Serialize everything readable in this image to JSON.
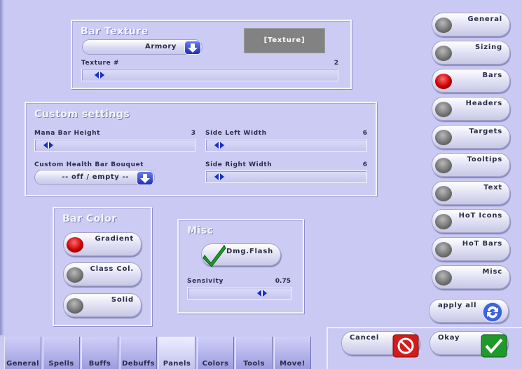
{
  "bar_texture": {
    "title": "Bar Texture",
    "texture_dropdown": "Armory",
    "texture_preview": "[Texture]",
    "texture_num_label": "Texture #",
    "texture_num_value": "2",
    "texture_num_level": 0.05
  },
  "custom_settings": {
    "title": "Custom settings",
    "mana_bar_height_label": "Mana Bar Height",
    "mana_bar_height_value": "3",
    "mana_bar_height_level": 0.05,
    "side_left_width_label": "Side Left Width",
    "side_left_width_value": "6",
    "side_left_width_level": 0.05,
    "bouquet_label": "Custom Health Bar Bouquet",
    "bouquet_dropdown": "-- off / empty --",
    "side_right_width_label": "Side Right Width",
    "side_right_width_value": "6",
    "side_right_width_level": 0.05
  },
  "bar_color": {
    "title": "Bar Color",
    "options": [
      {
        "label": "Gradient",
        "selected": true
      },
      {
        "label": "Class Col.",
        "selected": false
      },
      {
        "label": "Solid",
        "selected": false
      }
    ]
  },
  "misc": {
    "title": "Misc",
    "dmg_flash_label": "Dmg.Flash",
    "dmg_flash_checked": true,
    "sensivity_label": "Sensivity",
    "sensivity_value": "0.75",
    "sensivity_level": 0.75
  },
  "right_nav": [
    {
      "label": "General",
      "active": false
    },
    {
      "label": "Sizing",
      "active": false
    },
    {
      "label": "Bars",
      "active": true
    },
    {
      "label": "Headers",
      "active": false
    },
    {
      "label": "Targets",
      "active": false
    },
    {
      "label": "Tooltips",
      "active": false
    },
    {
      "label": "Text",
      "active": false
    },
    {
      "label": "HoT Icons",
      "active": false
    },
    {
      "label": "HoT Bars",
      "active": false
    },
    {
      "label": "Misc",
      "active": false
    }
  ],
  "actions": {
    "apply_all": "apply all",
    "cancel": "Cancel",
    "okay": "Okay"
  },
  "bottom_tabs": [
    {
      "label": "General",
      "active": false
    },
    {
      "label": "Spells",
      "active": false
    },
    {
      "label": "Buffs",
      "active": false
    },
    {
      "label": "Debuffs",
      "active": false
    },
    {
      "label": "Panels",
      "active": true
    },
    {
      "label": "Colors",
      "active": false
    },
    {
      "label": "Tools",
      "active": false
    },
    {
      "label": "Move!",
      "active": false
    }
  ],
  "colors": {
    "window_bg": "#c9c9f3",
    "panel_title": "#f4f4ff",
    "led_on": "#c90000",
    "led_off": "#6f6f6f",
    "arrow_blue": "#1c2fb8",
    "ok_green": "#1f9a2a",
    "cancel_red": "#d21c1c"
  },
  "icons": {
    "dropdown_arrow": "arrow-down-icon",
    "slider_thumb": "double-arrow-icon",
    "apply_all": "refresh-icon",
    "cancel": "no-entry-icon",
    "okay": "checkmark-icon"
  }
}
